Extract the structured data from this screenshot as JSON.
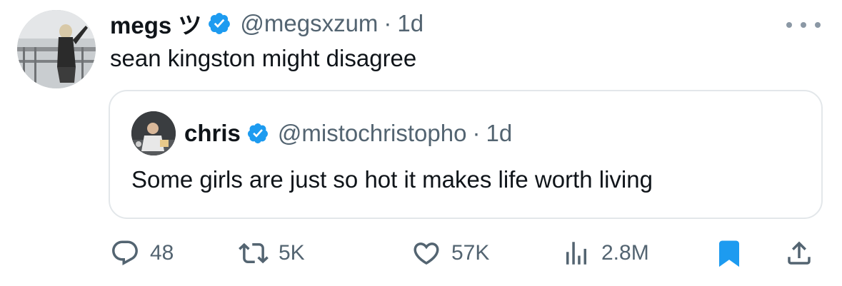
{
  "tweet": {
    "author_name": "megs ツ",
    "author_handle": "@megsxzum",
    "separator": "·",
    "time": "1d",
    "text": "sean kingston might disagree"
  },
  "quoted": {
    "author_name": "chris",
    "author_handle": "@mistochristopho",
    "separator": "·",
    "time": "1d",
    "text": "Some girls are just so hot it makes life worth living"
  },
  "actions": {
    "replies": "48",
    "reposts": "5K",
    "likes": "57K",
    "views": "2.8M"
  },
  "icons": {
    "verified": "verified-badge-icon",
    "more": "more-icon",
    "reply": "reply-icon",
    "repost": "repost-icon",
    "like": "heart-icon",
    "views": "views-icon",
    "bookmark": "bookmark-icon",
    "share": "share-icon"
  },
  "colors": {
    "verified_blue": "#1d9bf0",
    "bookmark_blue": "#1d9bf0",
    "secondary_text": "#536471",
    "primary_text": "#0f1419",
    "quote_border": "#e3e7ea"
  }
}
